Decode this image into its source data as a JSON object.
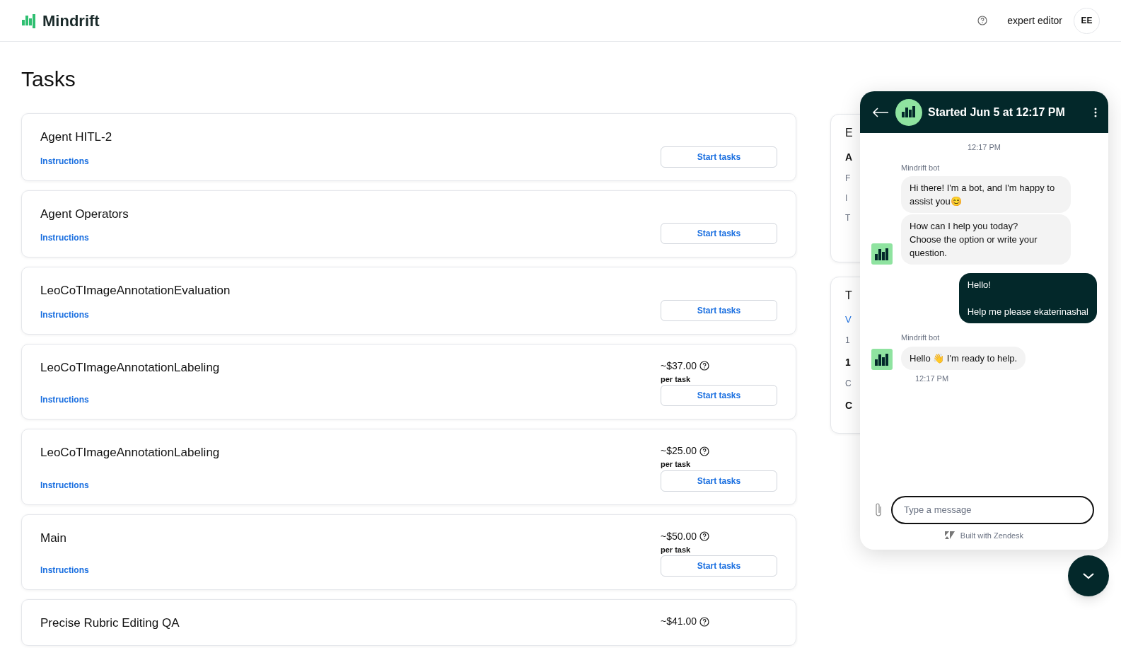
{
  "header": {
    "logo": "Mindrift",
    "user_name": "expert editor",
    "avatar_initials": "EE"
  },
  "page_title": "Tasks",
  "tasks": [
    {
      "name": "Agent HITL-2",
      "link": "Instructions",
      "button": "Start tasks"
    },
    {
      "name": "Agent Operators",
      "link": "Instructions",
      "button": "Start tasks"
    },
    {
      "name": "LeoCoTImageAnnotationEvaluation",
      "link": "Instructions",
      "button": "Start tasks"
    },
    {
      "name": "LeoCoTImageAnnotationLabeling",
      "price": "~$37.00",
      "price_unit": "per task",
      "link": "Instructions",
      "button": "Start tasks"
    },
    {
      "name": "LeoCoTImageAnnotationLabeling",
      "price": "~$25.00",
      "price_unit": "per task",
      "link": "Instructions",
      "button": "Start tasks"
    },
    {
      "name": "Main",
      "price": "~$50.00",
      "price_unit": "per task",
      "link": "Instructions",
      "button": "Start tasks"
    },
    {
      "name": "Precise Rubric Editing QA",
      "price": "~$41.00"
    }
  ],
  "side_cards": [
    {
      "lines": [
        {
          "text": "E",
          "kind": "title"
        },
        {
          "text": "A",
          "kind": "strong"
        },
        {
          "text": "F",
          "kind": "muted"
        },
        {
          "text": "I",
          "kind": "muted"
        },
        {
          "text": "T",
          "kind": "muted"
        }
      ]
    },
    {
      "lines": [
        {
          "text": "T",
          "kind": "title"
        },
        {
          "text": "V",
          "kind": "link"
        },
        {
          "text": "1",
          "kind": "muted"
        },
        {
          "text": "1",
          "kind": "strong"
        },
        {
          "text": "C",
          "kind": "muted"
        },
        {
          "text": "C",
          "kind": "strong"
        }
      ]
    }
  ],
  "chat": {
    "title": "Started Jun 5 at 12:17 PM",
    "timestamp": "12:17 PM",
    "messages": [
      {
        "kind": "bot",
        "sender": "Mindrift bot",
        "bubbles": [
          "Hi there! I'm a bot, and I'm happy to assist you😊",
          "How can I help you today?\nChoose the option or write your question."
        ]
      },
      {
        "kind": "user",
        "bubbles": [
          "Hello!\n\nHelp me please ekaterinashal"
        ]
      },
      {
        "kind": "bot",
        "sender": "Mindrift bot",
        "bubbles": [
          "Hello 👋 I'm ready to help."
        ],
        "time": "12:17 PM"
      }
    ],
    "input_placeholder": "Type a message",
    "footer": "Built with Zendesk"
  }
}
